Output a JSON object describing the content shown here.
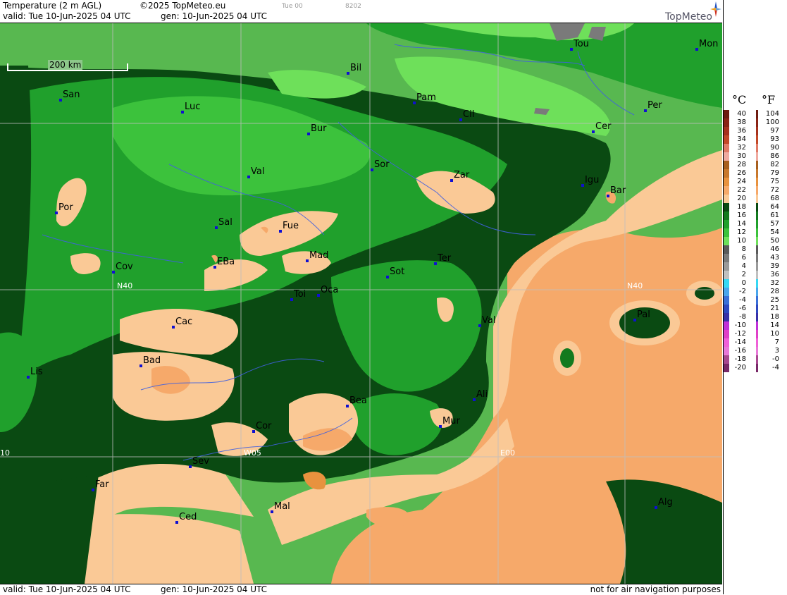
{
  "header": {
    "title": "Temperature (2 m AGL)",
    "copyright": "©2025 TopMeteo.eu",
    "run": "Tue 00",
    "code": "8202",
    "valid": "valid:  Tue  10-Jun-2025  04 UTC",
    "gen": "gen: 10-Jun-2025 04 UTC",
    "brand": "TopMeteo"
  },
  "footer": {
    "valid": "valid:  Tue  10-Jun-2025  04 UTC",
    "gen": "gen: 10-Jun-2025 04 UTC",
    "disclaimer": "not for air navigation purposes"
  },
  "scale_bar": "200 km",
  "grid_labels": [
    "N40",
    "N40",
    "W05",
    "E00",
    "10"
  ],
  "cities": [
    "Tou",
    "Mon",
    "Bil",
    "San",
    "Pam",
    "Luc",
    "Cil",
    "Per",
    "Bur",
    "Cer",
    "Sor",
    "Val",
    "Zar",
    "Igu",
    "Bar",
    "Por",
    "Sal",
    "Fue",
    "Mad",
    "EBa",
    "Cov",
    "Ter",
    "Sot",
    "Toi",
    "Oca",
    "Val",
    "Pal",
    "Cac",
    "Bad",
    "Lis",
    "Bea",
    "Ali",
    "Mur",
    "Cor",
    "W05",
    "Sev",
    "Far",
    "Mal",
    "Alg",
    "Ced"
  ],
  "legend": {
    "celsius_unit": "°C",
    "fahrenheit_unit": "°F",
    "rows": [
      {
        "c": "40",
        "f": "104",
        "color": "#6e1c10"
      },
      {
        "c": "38",
        "f": "100",
        "color": "#8a2416"
      },
      {
        "c": "36",
        "f": "97",
        "color": "#a6321e"
      },
      {
        "c": "34",
        "f": "93",
        "color": "#c24828"
      },
      {
        "c": "32",
        "f": "90",
        "color": "#e07a66"
      },
      {
        "c": "30",
        "f": "86",
        "color": "#f0aaa0"
      },
      {
        "c": "28",
        "f": "82",
        "color": "#a85f1e"
      },
      {
        "c": "26",
        "f": "79",
        "color": "#c8782c"
      },
      {
        "c": "24",
        "f": "75",
        "color": "#e8923e"
      },
      {
        "c": "22",
        "f": "72",
        "color": "#f6a96a"
      },
      {
        "c": "20",
        "f": "68",
        "color": "#fac996"
      },
      {
        "c": "18",
        "f": "64",
        "color": "#0a4a12"
      },
      {
        "c": "16",
        "f": "61",
        "color": "#137a1e"
      },
      {
        "c": "14",
        "f": "57",
        "color": "#20a02c"
      },
      {
        "c": "12",
        "f": "54",
        "color": "#3cc23c"
      },
      {
        "c": "10",
        "f": "50",
        "color": "#6ee05a"
      },
      {
        "c": "8",
        "f": "46",
        "color": "#5a5a5a"
      },
      {
        "c": "6",
        "f": "43",
        "color": "#7a7a7a"
      },
      {
        "c": "4",
        "f": "39",
        "color": "#9a9a9a"
      },
      {
        "c": "2",
        "f": "36",
        "color": "#c0c0c0"
      },
      {
        "c": "0",
        "f": "32",
        "color": "#36d8f4"
      },
      {
        "c": "-2",
        "f": "28",
        "color": "#4aa6ec"
      },
      {
        "c": "-4",
        "f": "25",
        "color": "#3a70d8"
      },
      {
        "c": "-6",
        "f": "21",
        "color": "#2e48c0"
      },
      {
        "c": "-8",
        "f": "18",
        "color": "#3830a8"
      },
      {
        "c": "-10",
        "f": "14",
        "color": "#c030d8"
      },
      {
        "c": "-12",
        "f": "10",
        "color": "#e040c8"
      },
      {
        "c": "-14",
        "f": "7",
        "color": "#f060d8"
      },
      {
        "c": "-16",
        "f": "3",
        "color": "#e878d8"
      },
      {
        "c": "-18",
        "f": "-0",
        "color": "#a84890"
      },
      {
        "c": "-20",
        "f": "-4",
        "color": "#782868"
      }
    ]
  }
}
